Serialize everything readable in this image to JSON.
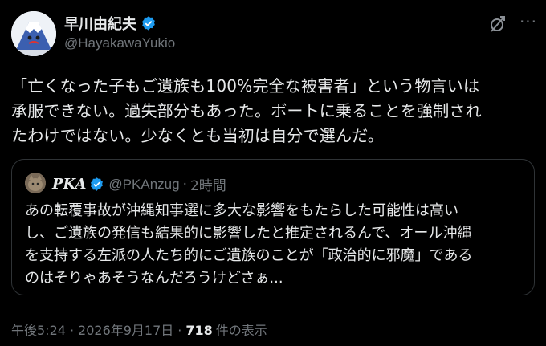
{
  "author": {
    "display_name": "早川由紀夫",
    "handle": "@HayakawaYukio",
    "avatar_icon": "mountain-face-avatar"
  },
  "tweet": {
    "lines": [
      "「亡くなった子もご遺族も100%完全な被害者」という物言いは",
      "承服できない。過失部分もあった。ボートに乗ることを強制され",
      "たわけではない。少なくとも当初は自分で選んだ。"
    ]
  },
  "quoted": {
    "display_name": "PKA",
    "handle": "@PKAnzug",
    "dot": "·",
    "time": "2時間",
    "avatar_icon": "cat-avatar",
    "lines": [
      "あの転覆事故が沖縄知事選に多大な影響をもたらした可能性は高い",
      "し、ご遺族の発信も結果的に影響したと推定されるんで、オール沖縄",
      "を支持する左派の人たち的にご遺族のことが「政治的に邪魔」である",
      "のはそりゃあそうなんだろうけどさぁ..."
    ]
  },
  "meta": {
    "time": "午後5:24",
    "sep": "·",
    "date": "2026年9月17日",
    "views_count": "718",
    "views_label": "件の表示"
  },
  "colors": {
    "background": "#000000",
    "text": "#e7e9ea",
    "secondary": "#71767b",
    "verified": "#1d9bf0",
    "border": "#2f3336"
  }
}
